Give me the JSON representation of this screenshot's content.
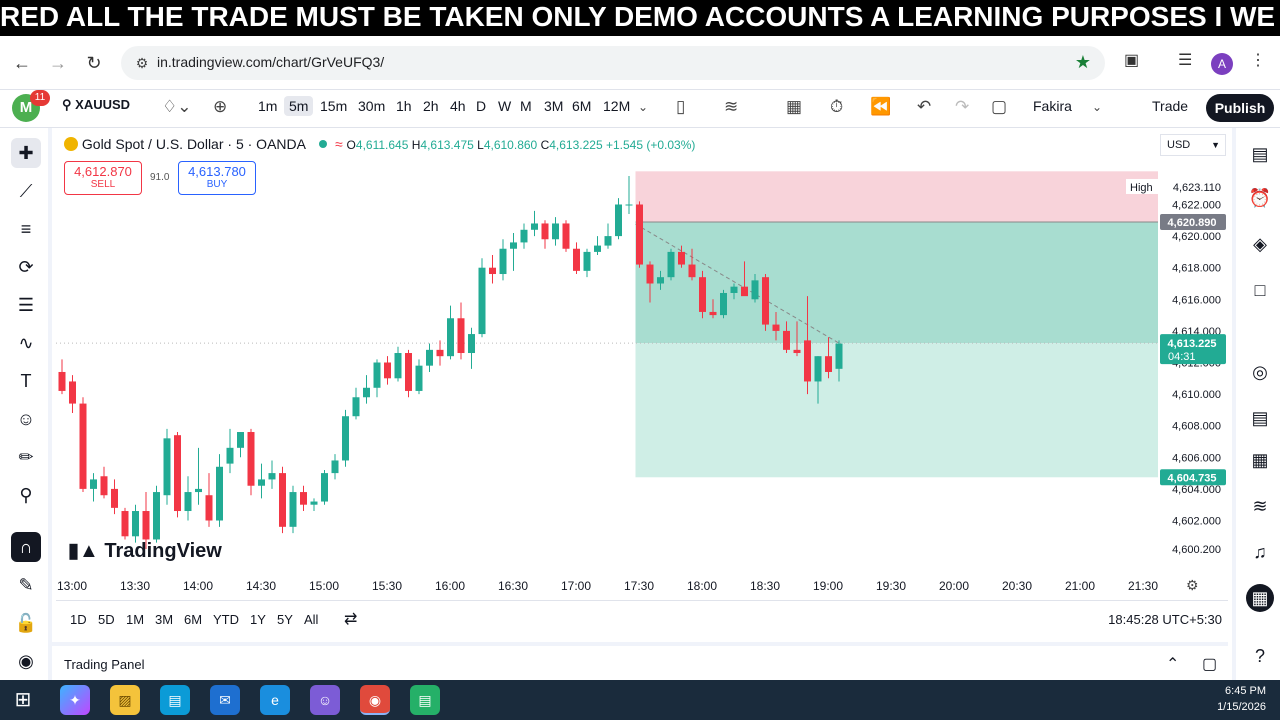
{
  "banner": {
    "text": "RED ALL THE TRADE MUST BE TAKEN ONLY DEMO ACCOUNTS A LEARNING PURPOSES I WE DO"
  },
  "browser": {
    "url": "in.tradingview.com/chart/GrVeUFQ3/",
    "profile_initial": "A"
  },
  "toolbar": {
    "avatar_initial": "M",
    "notifications": "11",
    "symbol": "XAUUSD",
    "timeframes": [
      "1m",
      "5m",
      "15m",
      "30m",
      "1h",
      "2h",
      "4h",
      "D",
      "W",
      "M",
      "3M",
      "6M",
      "12M"
    ],
    "active_timeframe": "5m",
    "layout_name": "Fakira",
    "trade_label": "Trade",
    "publish_label": "Publish"
  },
  "legend": {
    "title": "Gold Spot / U.S. Dollar · 5 · OANDA",
    "open_label": "O",
    "open": "4,611.645",
    "high_label": "H",
    "high": "4,613.475",
    "low_label": "L",
    "low": "4,610.860",
    "close_label": "C",
    "close": "4,613.225",
    "change": "+1.545 (+0.03%)"
  },
  "order": {
    "sell_price": "4,612.870",
    "sell_label": "SELL",
    "spread": "91.0",
    "buy_price": "4,613.780",
    "buy_label": "BUY"
  },
  "price_axis": {
    "currency": "USD",
    "ticks": [
      "4,623.110",
      "4,622.000",
      "4,620.000",
      "4,618.000",
      "4,616.000",
      "4,614.000",
      "4,612.000",
      "4,610.000",
      "4,608.000",
      "4,606.000",
      "4,604.000",
      "4,602.000",
      "4,600.200"
    ],
    "high_tag": "High",
    "stop_label": "4,620.890",
    "current_price": "4,613.225",
    "countdown": "04:31",
    "target_label": "4,604.735"
  },
  "time_axis": {
    "ticks": [
      "13:00",
      "13:30",
      "14:00",
      "14:30",
      "15:00",
      "15:30",
      "16:00",
      "16:30",
      "17:00",
      "17:30",
      "18:00",
      "18:30",
      "19:00",
      "19:30",
      "20:00",
      "20:30",
      "21:00",
      "21:30"
    ]
  },
  "chart_data": {
    "type": "candlestick",
    "ylim": [
      4599.5,
      4624.5
    ],
    "candles": [
      {
        "o": 4611.4,
        "h": 4612.2,
        "l": 4610.0,
        "c": 4610.2
      },
      {
        "o": 4610.8,
        "h": 4611.2,
        "l": 4608.8,
        "c": 4609.4
      },
      {
        "o": 4609.4,
        "h": 4609.8,
        "l": 4603.8,
        "c": 4604.0
      },
      {
        "o": 4604.0,
        "h": 4605.0,
        "l": 4603.2,
        "c": 4604.6
      },
      {
        "o": 4604.8,
        "h": 4605.4,
        "l": 4603.4,
        "c": 4603.6
      },
      {
        "o": 4604.0,
        "h": 4604.6,
        "l": 4602.4,
        "c": 4602.8
      },
      {
        "o": 4602.6,
        "h": 4602.8,
        "l": 4600.8,
        "c": 4601.0
      },
      {
        "o": 4601.0,
        "h": 4603.0,
        "l": 4600.6,
        "c": 4602.6
      },
      {
        "o": 4602.6,
        "h": 4603.8,
        "l": 4600.2,
        "c": 4600.8
      },
      {
        "o": 4600.8,
        "h": 4604.2,
        "l": 4600.6,
        "c": 4603.8
      },
      {
        "o": 4603.6,
        "h": 4607.8,
        "l": 4603.0,
        "c": 4607.2
      },
      {
        "o": 4607.4,
        "h": 4607.6,
        "l": 4602.2,
        "c": 4602.6
      },
      {
        "o": 4602.6,
        "h": 4604.8,
        "l": 4602.0,
        "c": 4603.8
      },
      {
        "o": 4603.8,
        "h": 4606.6,
        "l": 4603.0,
        "c": 4604.0
      },
      {
        "o": 4603.6,
        "h": 4605.0,
        "l": 4601.6,
        "c": 4602.0
      },
      {
        "o": 4602.0,
        "h": 4606.2,
        "l": 4601.6,
        "c": 4605.4
      },
      {
        "o": 4605.6,
        "h": 4607.8,
        "l": 4605.0,
        "c": 4606.6
      },
      {
        "o": 4606.6,
        "h": 4607.6,
        "l": 4606.0,
        "c": 4607.6
      },
      {
        "o": 4607.6,
        "h": 4607.8,
        "l": 4603.6,
        "c": 4604.2
      },
      {
        "o": 4604.2,
        "h": 4605.6,
        "l": 4603.4,
        "c": 4604.6
      },
      {
        "o": 4604.6,
        "h": 4605.8,
        "l": 4604.0,
        "c": 4605.0
      },
      {
        "o": 4605.0,
        "h": 4605.4,
        "l": 4601.2,
        "c": 4601.6
      },
      {
        "o": 4601.6,
        "h": 4604.2,
        "l": 4601.2,
        "c": 4603.8
      },
      {
        "o": 4603.8,
        "h": 4604.2,
        "l": 4602.6,
        "c": 4603.0
      },
      {
        "o": 4603.0,
        "h": 4603.4,
        "l": 4602.6,
        "c": 4603.2
      },
      {
        "o": 4603.2,
        "h": 4605.2,
        "l": 4603.0,
        "c": 4605.0
      },
      {
        "o": 4605.0,
        "h": 4606.2,
        "l": 4604.6,
        "c": 4605.8
      },
      {
        "o": 4605.8,
        "h": 4609.0,
        "l": 4605.4,
        "c": 4608.6
      },
      {
        "o": 4608.6,
        "h": 4610.4,
        "l": 4608.4,
        "c": 4609.8
      },
      {
        "o": 4609.8,
        "h": 4611.2,
        "l": 4609.4,
        "c": 4610.4
      },
      {
        "o": 4610.4,
        "h": 4612.2,
        "l": 4609.8,
        "c": 4612.0
      },
      {
        "o": 4612.0,
        "h": 4612.4,
        "l": 4610.6,
        "c": 4611.0
      },
      {
        "o": 4611.0,
        "h": 4613.0,
        "l": 4610.8,
        "c": 4612.6
      },
      {
        "o": 4612.6,
        "h": 4612.8,
        "l": 4609.8,
        "c": 4610.2
      },
      {
        "o": 4610.2,
        "h": 4612.2,
        "l": 4610.0,
        "c": 4611.8
      },
      {
        "o": 4611.8,
        "h": 4613.2,
        "l": 4611.4,
        "c": 4612.8
      },
      {
        "o": 4612.8,
        "h": 4613.4,
        "l": 4611.8,
        "c": 4612.4
      },
      {
        "o": 4612.4,
        "h": 4615.6,
        "l": 4612.2,
        "c": 4614.8
      },
      {
        "o": 4614.8,
        "h": 4615.8,
        "l": 4612.2,
        "c": 4612.6
      },
      {
        "o": 4612.6,
        "h": 4614.2,
        "l": 4611.6,
        "c": 4613.8
      },
      {
        "o": 4613.8,
        "h": 4618.6,
        "l": 4613.6,
        "c": 4618.0
      },
      {
        "o": 4618.0,
        "h": 4618.8,
        "l": 4617.0,
        "c": 4617.6
      },
      {
        "o": 4617.6,
        "h": 4619.8,
        "l": 4617.2,
        "c": 4619.2
      },
      {
        "o": 4619.2,
        "h": 4620.2,
        "l": 4617.8,
        "c": 4619.6
      },
      {
        "o": 4619.6,
        "h": 4620.8,
        "l": 4619.2,
        "c": 4620.4
      },
      {
        "o": 4620.4,
        "h": 4621.6,
        "l": 4620.0,
        "c": 4620.8
      },
      {
        "o": 4620.8,
        "h": 4621.0,
        "l": 4619.2,
        "c": 4619.8
      },
      {
        "o": 4619.8,
        "h": 4621.2,
        "l": 4619.4,
        "c": 4620.8
      },
      {
        "o": 4620.8,
        "h": 4621.0,
        "l": 4619.0,
        "c": 4619.2
      },
      {
        "o": 4619.2,
        "h": 4619.6,
        "l": 4617.6,
        "c": 4617.8
      },
      {
        "o": 4617.8,
        "h": 4619.2,
        "l": 4617.4,
        "c": 4619.0
      },
      {
        "o": 4619.0,
        "h": 4620.0,
        "l": 4618.8,
        "c": 4619.4
      },
      {
        "o": 4619.4,
        "h": 4620.8,
        "l": 4619.2,
        "c": 4620.0
      },
      {
        "o": 4620.0,
        "h": 4622.4,
        "l": 4619.8,
        "c": 4622.0
      },
      {
        "o": 4622.0,
        "h": 4623.8,
        "l": 4621.4,
        "c": 4622.0
      },
      {
        "o": 4622.0,
        "h": 4622.2,
        "l": 4618.0,
        "c": 4618.2
      },
      {
        "o": 4618.2,
        "h": 4618.4,
        "l": 4615.8,
        "c": 4617.0
      },
      {
        "o": 4617.0,
        "h": 4617.8,
        "l": 4616.6,
        "c": 4617.4
      },
      {
        "o": 4617.4,
        "h": 4619.2,
        "l": 4617.2,
        "c": 4619.0
      },
      {
        "o": 4619.0,
        "h": 4619.4,
        "l": 4618.0,
        "c": 4618.2
      },
      {
        "o": 4618.2,
        "h": 4619.2,
        "l": 4617.2,
        "c": 4617.4
      },
      {
        "o": 4617.4,
        "h": 4617.8,
        "l": 4614.8,
        "c": 4615.2
      },
      {
        "o": 4615.2,
        "h": 4616.0,
        "l": 4614.8,
        "c": 4615.0
      },
      {
        "o": 4615.0,
        "h": 4616.6,
        "l": 4614.8,
        "c": 4616.4
      },
      {
        "o": 4616.4,
        "h": 4617.0,
        "l": 4616.0,
        "c": 4616.8
      },
      {
        "o": 4616.8,
        "h": 4618.4,
        "l": 4616.4,
        "c": 4616.2
      },
      {
        "o": 4616.0,
        "h": 4617.6,
        "l": 4615.8,
        "c": 4617.2
      },
      {
        "o": 4617.4,
        "h": 4617.6,
        "l": 4614.0,
        "c": 4614.4
      },
      {
        "o": 4614.4,
        "h": 4615.2,
        "l": 4613.4,
        "c": 4614.0
      },
      {
        "o": 4614.0,
        "h": 4614.6,
        "l": 4612.6,
        "c": 4612.8
      },
      {
        "o": 4612.8,
        "h": 4614.6,
        "l": 4612.4,
        "c": 4612.6
      },
      {
        "o": 4613.4,
        "h": 4616.2,
        "l": 4610.0,
        "c": 4610.8
      },
      {
        "o": 4610.8,
        "h": 4612.4,
        "l": 4609.4,
        "c": 4612.4
      },
      {
        "o": 4612.4,
        "h": 4613.6,
        "l": 4611.0,
        "c": 4611.4
      },
      {
        "o": 4611.6,
        "h": 4613.4,
        "l": 4610.8,
        "c": 4613.2
      }
    ],
    "position": {
      "type": "short",
      "entry": 4613.225,
      "stop": 4620.89,
      "target": 4604.735
    }
  },
  "ranges": [
    "1D",
    "5D",
    "1M",
    "3M",
    "6M",
    "YTD",
    "1Y",
    "5Y",
    "All"
  ],
  "clock": "18:45:28 UTC+5:30",
  "panel": {
    "label": "Trading Panel"
  },
  "watermark": "TradingView",
  "taskbar": {
    "time": "6:45 PM",
    "date": "1/15/2026"
  },
  "colors": {
    "up": "#22ab94",
    "down": "#f23645",
    "stop_zone": "#f8d3da",
    "target_zone_upper": "#a8ddd0",
    "target_zone_lower": "#cfeee6"
  }
}
